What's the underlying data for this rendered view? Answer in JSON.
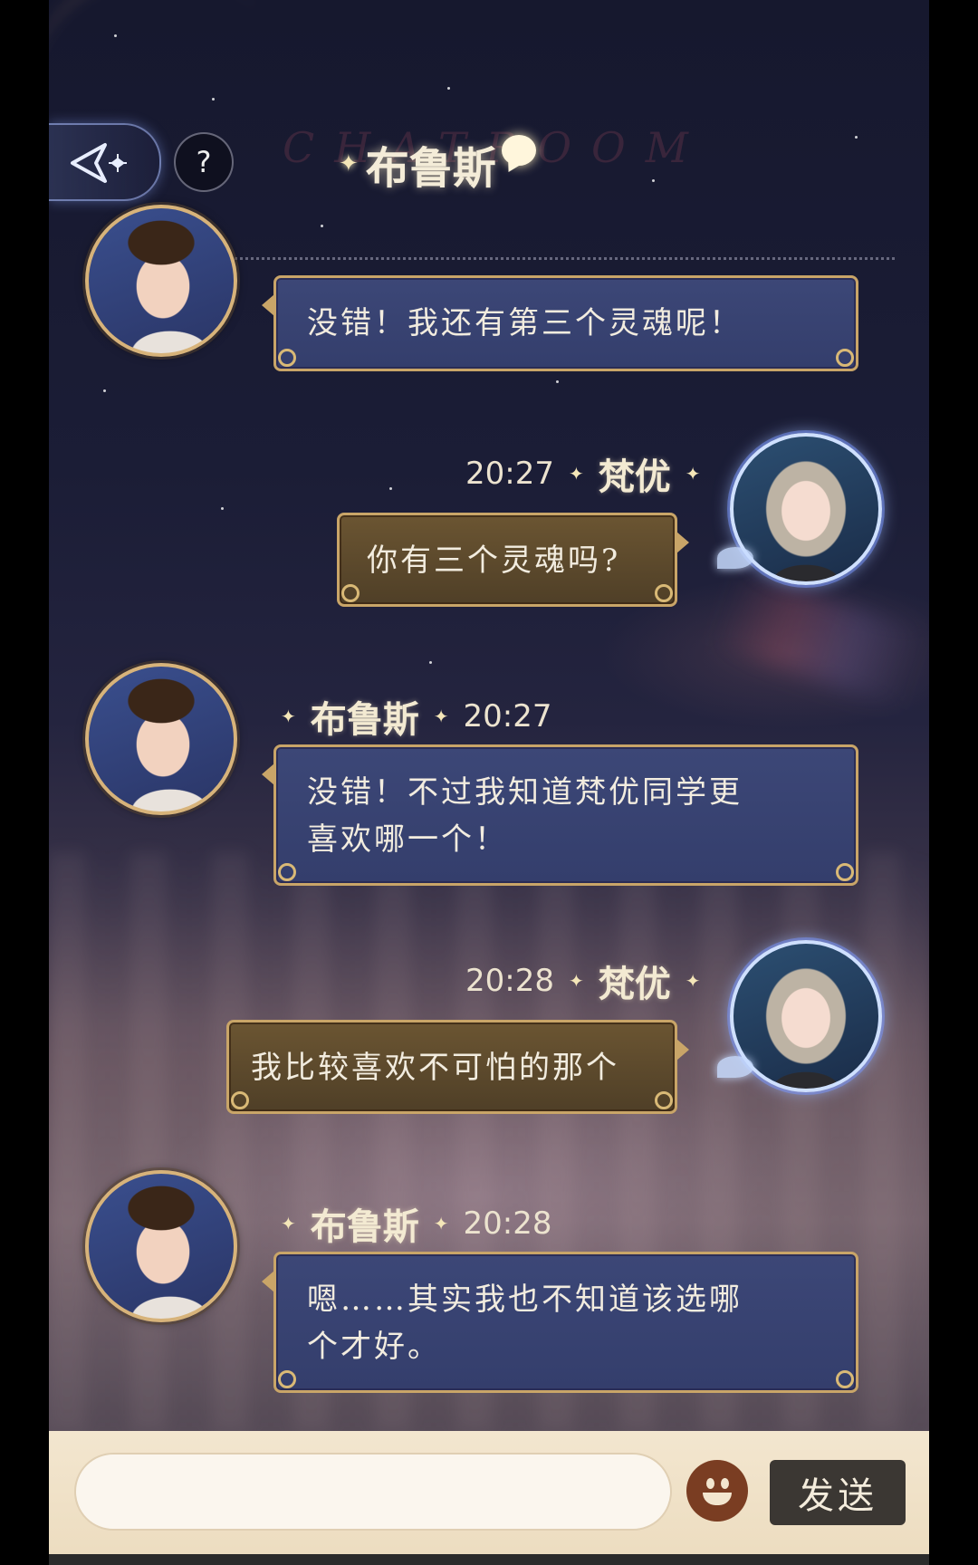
{
  "header": {
    "title": "布鲁斯",
    "watermark": "CHATROOM",
    "help_label": "?"
  },
  "messages": [
    {
      "sender": "布鲁斯",
      "time": "",
      "text": [
        "没错！我还有第三个灵魂呢！"
      ],
      "side": "left"
    },
    {
      "sender": "梵优",
      "time": "20:27",
      "text": [
        "你有三个灵魂吗?"
      ],
      "side": "right"
    },
    {
      "sender": "布鲁斯",
      "time": "20:27",
      "text": [
        "没错！不过我知道梵优同学更",
        "喜欢哪一个！"
      ],
      "side": "left"
    },
    {
      "sender": "梵优",
      "time": "20:28",
      "text": [
        "我比较喜欢不可怕的那个"
      ],
      "side": "right"
    },
    {
      "sender": "布鲁斯",
      "time": "20:28",
      "text": [
        "嗯……其实我也不知道该选哪",
        "个才好。"
      ],
      "side": "left"
    }
  ],
  "input": {
    "value": "",
    "placeholder": ""
  },
  "send_label": "发送",
  "colors": {
    "bubble_left": "#3c4777",
    "bubble_right": "#6b5532",
    "bubble_border": "#c9a568",
    "input_bar": "#f3e6cf",
    "send_button": "#3b3733"
  },
  "icons": {
    "back": "back-arrow-icon",
    "help": "help-icon",
    "emoji": "emoji-icon",
    "title_decoration": "chat-bubble-icon"
  }
}
